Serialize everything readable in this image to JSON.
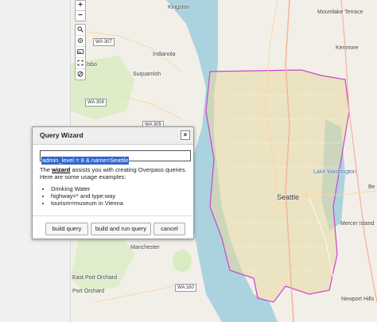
{
  "dialog": {
    "title": "Query Wizard",
    "close_label": "×",
    "query_value": "admin_level = 8 & name=Seattle",
    "intro_prefix": "The ",
    "intro_link": "wizard",
    "intro_suffix": " assists you with creating Overpass queries. Here are some usage examples:",
    "examples": [
      "Drinking Water",
      "highway=* and type:way",
      "tourism=museum in Vienna"
    ],
    "buttons": {
      "build": "build query",
      "build_run": "build and run query",
      "cancel": "cancel"
    }
  },
  "map_controls": {
    "zoom_in": "+",
    "zoom_out": "−",
    "tools": [
      "search-icon",
      "locate-icon",
      "image-icon",
      "fullscreen-icon",
      "data-icon"
    ]
  },
  "map_labels": {
    "kingston": "Kingston",
    "mountlake_terrace": "Mountlake Terrace",
    "kenmore": "Kenmore",
    "indianola": "Indianola",
    "suquamish": "Suquamish",
    "lake_washington": "Lake Washington",
    "seattle": "Seattle",
    "mercer_island": "Mercer Island",
    "newport_hills": "Newport Hills",
    "manchester": "Manchester",
    "port_orchard": "Port Orchard",
    "east_port_orchard": "East Port Orchard",
    "bellevue_partial": "Be",
    "kitsap_partial": "lsbo",
    "wa307": "WA 307",
    "wa308": "WA 308",
    "wa305": "WA 305",
    "wa160": "WA 160"
  },
  "colors": {
    "water": "#aad3df",
    "land": "#f2efe9",
    "boundary": "#cc44cc",
    "highlight": "#e5d8a0"
  }
}
